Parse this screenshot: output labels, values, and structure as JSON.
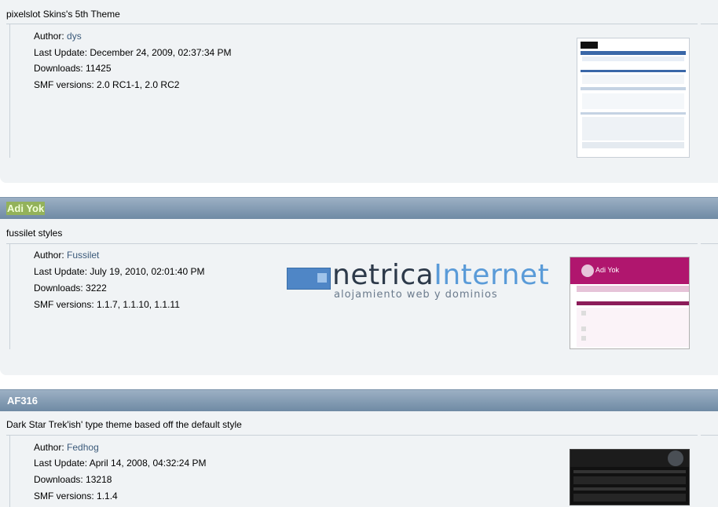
{
  "themes": [
    {
      "description": "pixelslot Skins's 5th Theme",
      "author_label": "Author:",
      "author": "dys",
      "last_update_label": "Last Update:",
      "last_update": "December 24, 2009, 02:37:34 PM",
      "downloads_label": "Downloads:",
      "downloads": "11425",
      "smf_label": "SMF versions:",
      "smf_versions": "2.0 RC1-1, 2.0 RC2"
    },
    {
      "title": "Adi Yok",
      "description": "fussilet styles",
      "author_label": "Author:",
      "author": "Fussilet",
      "last_update_label": "Last Update:",
      "last_update": "July 19, 2010, 02:01:40 PM",
      "downloads_label": "Downloads:",
      "downloads": "3222",
      "smf_label": "SMF versions:",
      "smf_versions": "1.1.7, 1.1.10, 1.1.11"
    },
    {
      "title": "AF316",
      "description": "Dark Star Trek'ish' type theme based off the default style",
      "author_label": "Author:",
      "author": "Fedhog",
      "last_update_label": "Last Update:",
      "last_update": "April 14, 2008, 04:32:24 PM",
      "downloads_label": "Downloads:",
      "downloads": "13218",
      "smf_label": "SMF versions:",
      "smf_versions": "1.1.4"
    }
  ],
  "ad": {
    "brand_dark": "netrica",
    "brand_light": "Internet",
    "tagline": "alojamiento web y dominios"
  },
  "thumb2": {
    "title": "Adi Yok"
  },
  "colors": {
    "header_top": "#9cb0c4",
    "header_bottom": "#6f8aa4",
    "panel_bg": "#f0f3f5",
    "link": "#3b5a7a",
    "highlight": "#93b25a"
  }
}
